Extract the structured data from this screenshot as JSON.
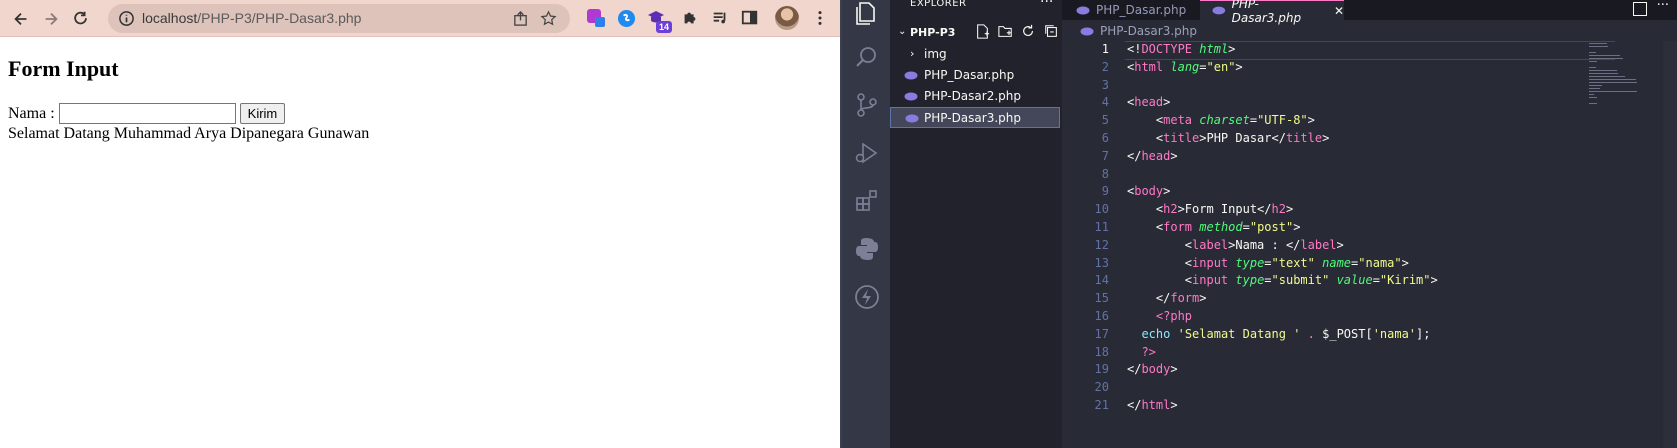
{
  "browser": {
    "url_host": "localhost",
    "url_path": "/PHP-P3/PHP-Dasar3.php",
    "ext_badge": "14",
    "page": {
      "heading": "Form Input",
      "label": "Nama :",
      "input_value": "",
      "submit_label": "Kirim",
      "output": "Selamat Datang Muhammad Arya Dipanegara Gunawan"
    }
  },
  "vscode": {
    "explorer_title": "EXPLORER",
    "project": "PHP-P3",
    "tree": [
      {
        "label": "img",
        "type": "folder"
      },
      {
        "label": "PHP_Dasar.php",
        "type": "php"
      },
      {
        "label": "PHP-Dasar2.php",
        "type": "php"
      },
      {
        "label": "PHP-Dasar3.php",
        "type": "php",
        "selected": true
      }
    ],
    "tabs": [
      {
        "label": "PHP_Dasar.php",
        "active": false
      },
      {
        "label": "PHP-Dasar3.php",
        "active": true
      }
    ],
    "breadcrumb": "PHP-Dasar3.php",
    "current_line": 1,
    "lines": [
      {
        "n": "1",
        "tokens": [
          [
            "t-txt",
            "<!"
          ],
          [
            "t-tag",
            "DOCTYPE"
          ],
          [
            "t-txt",
            " "
          ],
          [
            "t-attr",
            "html"
          ],
          [
            "t-txt",
            ">"
          ]
        ]
      },
      {
        "n": "2",
        "tokens": [
          [
            "t-txt",
            "<"
          ],
          [
            "t-tag",
            "html"
          ],
          [
            "t-txt",
            " "
          ],
          [
            "t-attr",
            "lang"
          ],
          [
            "t-txt",
            "="
          ],
          [
            "t-str",
            "\"en\""
          ],
          [
            "t-txt",
            ">"
          ]
        ]
      },
      {
        "n": "3",
        "tokens": []
      },
      {
        "n": "4",
        "tokens": [
          [
            "t-txt",
            "<"
          ],
          [
            "t-tag",
            "head"
          ],
          [
            "t-txt",
            ">"
          ]
        ]
      },
      {
        "n": "5",
        "tokens": [
          [
            "t-txt",
            "    <"
          ],
          [
            "t-tag",
            "meta"
          ],
          [
            "t-txt",
            " "
          ],
          [
            "t-attr",
            "charset"
          ],
          [
            "t-txt",
            "="
          ],
          [
            "t-str",
            "\"UTF-8\""
          ],
          [
            "t-txt",
            ">"
          ]
        ]
      },
      {
        "n": "6",
        "tokens": [
          [
            "t-txt",
            "    <"
          ],
          [
            "t-tag",
            "title"
          ],
          [
            "t-txt",
            ">PHP Dasar</"
          ],
          [
            "t-tag",
            "title"
          ],
          [
            "t-txt",
            ">"
          ]
        ]
      },
      {
        "n": "7",
        "tokens": [
          [
            "t-txt",
            "</"
          ],
          [
            "t-tag",
            "head"
          ],
          [
            "t-txt",
            ">"
          ]
        ]
      },
      {
        "n": "8",
        "tokens": []
      },
      {
        "n": "9",
        "tokens": [
          [
            "t-txt",
            "<"
          ],
          [
            "t-tag",
            "body"
          ],
          [
            "t-txt",
            ">"
          ]
        ]
      },
      {
        "n": "10",
        "tokens": [
          [
            "t-txt",
            "    <"
          ],
          [
            "t-tag",
            "h2"
          ],
          [
            "t-txt",
            ">Form Input</"
          ],
          [
            "t-tag",
            "h2"
          ],
          [
            "t-txt",
            ">"
          ]
        ]
      },
      {
        "n": "11",
        "tokens": [
          [
            "t-txt",
            "    <"
          ],
          [
            "t-tag",
            "form"
          ],
          [
            "t-txt",
            " "
          ],
          [
            "t-attr",
            "method"
          ],
          [
            "t-txt",
            "="
          ],
          [
            "t-str",
            "\"post\""
          ],
          [
            "t-txt",
            ">"
          ]
        ]
      },
      {
        "n": "12",
        "tokens": [
          [
            "t-txt",
            "        <"
          ],
          [
            "t-tag",
            "label"
          ],
          [
            "t-txt",
            ">Nama : </"
          ],
          [
            "t-tag",
            "label"
          ],
          [
            "t-txt",
            ">"
          ]
        ]
      },
      {
        "n": "13",
        "tokens": [
          [
            "t-txt",
            "        <"
          ],
          [
            "t-tag",
            "input"
          ],
          [
            "t-txt",
            " "
          ],
          [
            "t-attr",
            "type"
          ],
          [
            "t-txt",
            "="
          ],
          [
            "t-str",
            "\"text\""
          ],
          [
            "t-txt",
            " "
          ],
          [
            "t-attr",
            "name"
          ],
          [
            "t-txt",
            "="
          ],
          [
            "t-str",
            "\"nama\""
          ],
          [
            "t-txt",
            ">"
          ]
        ]
      },
      {
        "n": "14",
        "tokens": [
          [
            "t-txt",
            "        <"
          ],
          [
            "t-tag",
            "input"
          ],
          [
            "t-txt",
            " "
          ],
          [
            "t-attr",
            "type"
          ],
          [
            "t-txt",
            "="
          ],
          [
            "t-str",
            "\"submit\""
          ],
          [
            "t-txt",
            " "
          ],
          [
            "t-attr",
            "value"
          ],
          [
            "t-txt",
            "="
          ],
          [
            "t-str",
            "\"Kirim\""
          ],
          [
            "t-txt",
            ">"
          ]
        ]
      },
      {
        "n": "15",
        "tokens": [
          [
            "t-txt",
            "    </"
          ],
          [
            "t-tag",
            "form"
          ],
          [
            "t-txt",
            ">"
          ]
        ]
      },
      {
        "n": "16",
        "tokens": [
          [
            "t-tag",
            "    <?php"
          ]
        ]
      },
      {
        "n": "17",
        "tokens": [
          [
            "t-txt",
            "  "
          ],
          [
            "t-kw",
            "echo"
          ],
          [
            "t-txt",
            " "
          ],
          [
            "t-str",
            "'Selamat Datang '"
          ],
          [
            "t-txt",
            " "
          ],
          [
            "t-tag",
            "."
          ],
          [
            "t-txt",
            " $_POST["
          ],
          [
            "t-str",
            "'nama'"
          ],
          [
            "t-txt",
            "];"
          ]
        ]
      },
      {
        "n": "18",
        "tokens": [
          [
            "t-tag",
            "  ?>"
          ]
        ]
      },
      {
        "n": "19",
        "tokens": [
          [
            "t-txt",
            "</"
          ],
          [
            "t-tag",
            "body"
          ],
          [
            "t-txt",
            ">"
          ]
        ]
      },
      {
        "n": "20",
        "tokens": []
      },
      {
        "n": "21",
        "tokens": [
          [
            "t-txt",
            "</"
          ],
          [
            "t-tag",
            "html"
          ],
          [
            "t-txt",
            ">"
          ]
        ]
      }
    ]
  }
}
